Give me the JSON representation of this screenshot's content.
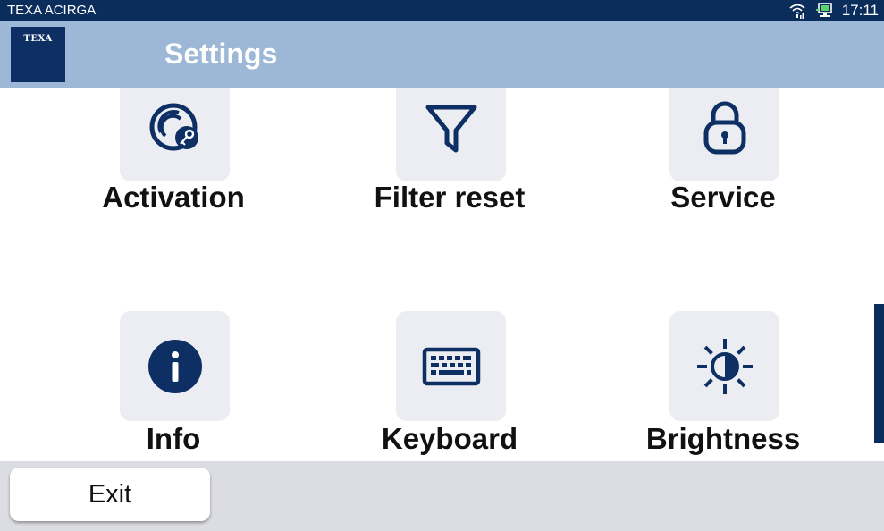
{
  "status_bar": {
    "app_name": "TEXA ACIRGA",
    "time": "17:11",
    "icons": [
      "wifi-icon",
      "monitor-connection-icon"
    ]
  },
  "header": {
    "logo_text": "TEXA",
    "title": "Settings"
  },
  "tiles": [
    {
      "label": "Activation",
      "icon": "activation-key-icon"
    },
    {
      "label": "Filter reset",
      "icon": "funnel-icon"
    },
    {
      "label": "Service",
      "icon": "padlock-icon"
    },
    {
      "label": "Info",
      "icon": "info-icon"
    },
    {
      "label": "Keyboard",
      "icon": "keyboard-icon"
    },
    {
      "label": "Brightness",
      "icon": "brightness-icon"
    }
  ],
  "footer": {
    "exit_label": "Exit"
  },
  "colors": {
    "navy": "#0b2d5c",
    "header_blue": "#9cb8d6",
    "tile_bg": "#ecedf2",
    "footer_bg": "#dcdde2"
  }
}
